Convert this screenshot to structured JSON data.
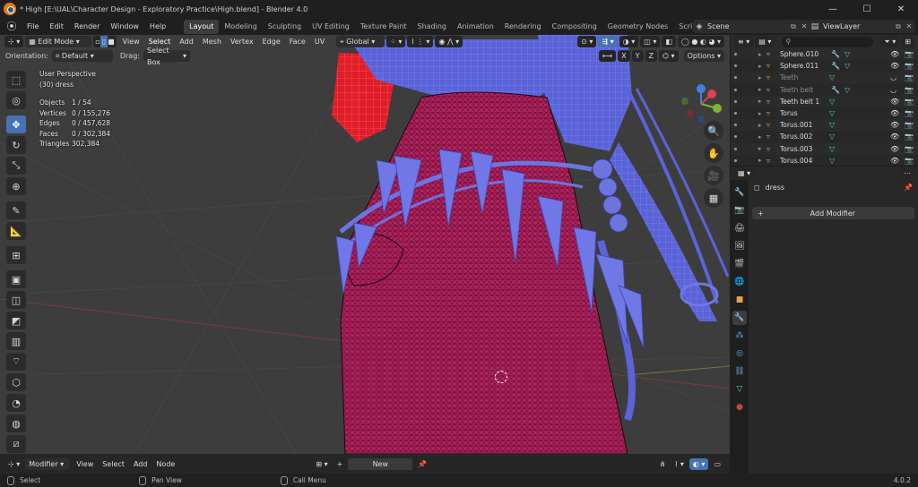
{
  "titlebar": {
    "title": "* High [E:\\UAL\\Character Design - Exploratory Practice\\High.blend] - Blender 4.0",
    "min": "—",
    "max": "☐",
    "close": "✕"
  },
  "menu": {
    "items": [
      "File",
      "Edit",
      "Render",
      "Window",
      "Help"
    ],
    "workspaces": [
      "Layout",
      "Modeling",
      "Sculpting",
      "UV Editing",
      "Texture Paint",
      "Shading",
      "Animation",
      "Rendering",
      "Compositing",
      "Geometry Nodes",
      "Scripting"
    ],
    "active_workspace": "Layout",
    "plus": "+",
    "scene": "Scene",
    "view_layer": "ViewLayer"
  },
  "viewport_header": {
    "mode": "Edit Mode",
    "menus": [
      "View",
      "Select",
      "Add",
      "Mesh",
      "Vertex",
      "Edge",
      "Face",
      "UV"
    ],
    "transform": "Global",
    "orientation_label": "Orientation:",
    "orientation": "Default",
    "drag_label": "Drag:",
    "drag": "Select Box",
    "axes": [
      "X",
      "Y",
      "Z"
    ],
    "options": "Options"
  },
  "overlay": {
    "perspective": "User Perspective",
    "object": "(30) dress",
    "stats": [
      {
        "k": "Objects",
        "v": "1 / 54"
      },
      {
        "k": "Vertices",
        "v": "0 / 155,276"
      },
      {
        "k": "Edges",
        "v": "0 / 457,628"
      },
      {
        "k": "Faces",
        "v": "0 / 302,384"
      },
      {
        "k": "Triangles",
        "v": "302,384"
      }
    ]
  },
  "outliner": {
    "rows": [
      {
        "name": "Sphere.010",
        "dim": false,
        "mod": true
      },
      {
        "name": "Sphere.011",
        "dim": false,
        "mod": true
      },
      {
        "name": "Teeth",
        "dim": true,
        "mod": false
      },
      {
        "name": "Teeth belt",
        "dim": true,
        "mod": true
      },
      {
        "name": "Teeth belt 1",
        "dim": false,
        "mod": false
      },
      {
        "name": "Torus",
        "dim": false,
        "mod": false
      },
      {
        "name": "Torus.001",
        "dim": false,
        "mod": false
      },
      {
        "name": "Torus.002",
        "dim": false,
        "mod": false
      },
      {
        "name": "Torus.003",
        "dim": false,
        "mod": false
      },
      {
        "name": "Torus.004",
        "dim": false,
        "mod": false
      }
    ]
  },
  "properties": {
    "object_name": "dress",
    "add_modifier": "Add Modifier"
  },
  "bottom_editor": {
    "mode": "Modifier",
    "menus": [
      "View",
      "Select",
      "Add",
      "Node"
    ],
    "new_button": "New"
  },
  "statusbar": {
    "select": "Select",
    "pan": "Pan View",
    "call_menu": "Call Menu",
    "version": "4.0.2"
  },
  "colors": {
    "dress": "#b3205e",
    "accessory": "#5a63d8",
    "accent": "#4772b3"
  }
}
